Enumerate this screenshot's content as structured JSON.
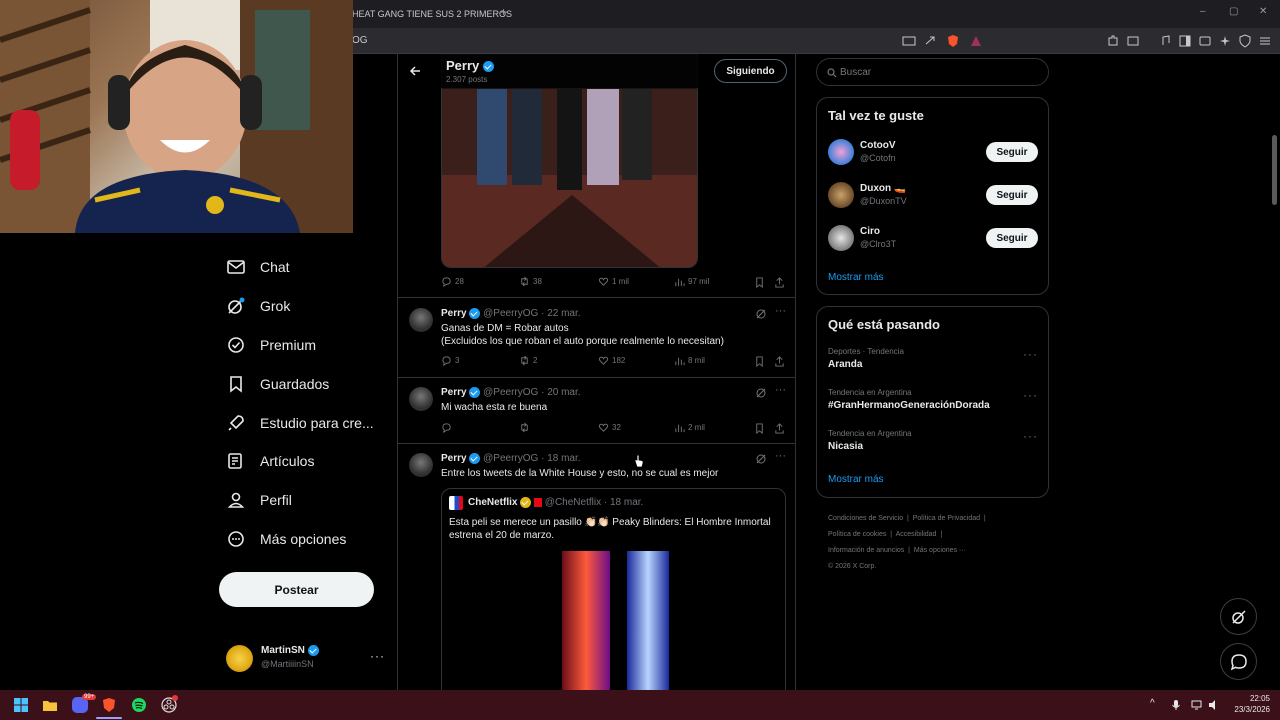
{
  "browser": {
    "tab_title": "HEAT GANG TIENE SUS 2 PRIMEROS",
    "tab_add": "+",
    "url": "OG",
    "window_controls": [
      "–",
      "▢",
      "✕"
    ]
  },
  "sidebar": {
    "items": [
      {
        "label": "Chat",
        "icon": "mail-icon"
      },
      {
        "label": "Grok",
        "icon": "grok-icon"
      },
      {
        "label": "Premium",
        "icon": "premium-icon"
      },
      {
        "label": "Guardados",
        "icon": "bookmark-icon"
      },
      {
        "label": "Estudio para cre...",
        "icon": "rocket-icon"
      },
      {
        "label": "Artículos",
        "icon": "articles-icon"
      },
      {
        "label": "Perfil",
        "icon": "profile-icon"
      },
      {
        "label": "Más opciones",
        "icon": "more-circle-icon"
      }
    ],
    "post_button": "Postear",
    "account": {
      "name": "MartinSN",
      "handle": "@MartiiiinSN",
      "more": "···"
    }
  },
  "header": {
    "name": "Perry",
    "posts": "2.307 posts",
    "following_button": "Siguiendo"
  },
  "tweets": [
    {
      "actions": {
        "replies": "28",
        "reposts": "38",
        "likes": "1 mil",
        "views": "97 mil"
      }
    },
    {
      "name": "Perry",
      "handle": "@PeerryOG",
      "date": "· 22 mar.",
      "text_line1": "Ganas de DM = Robar autos",
      "text_line2": "(Excluidos los que roban el auto porque realmente lo necesitan)",
      "actions": {
        "replies": "3",
        "reposts": "2",
        "likes": "182",
        "views": "8 mil"
      }
    },
    {
      "name": "Perry",
      "handle": "@PeerryOG",
      "date": "· 20 mar.",
      "text_line1": "Mi wacha esta re buena",
      "actions": {
        "replies": "",
        "reposts": "",
        "likes": "32",
        "views": "2 mil"
      }
    },
    {
      "name": "Perry",
      "handle": "@PeerryOG",
      "date": "· 18 mar.",
      "text_line1": "Entre los tweets de la White House y esto, no se cual es mejor",
      "quote": {
        "name": "CheNetflix",
        "handle": "@CheNetflix",
        "date": "· 18 mar.",
        "text_line1": "Esta peli se merece un pasillo 👏🏻👏🏻 Peaky Blinders: El Hombre Inmortal",
        "text_line2": "estrena el 20 de marzo."
      }
    }
  ],
  "right": {
    "search_placeholder": "Buscar",
    "suggest_title": "Tal vez te guste",
    "suggestions": [
      {
        "name": "CotooV",
        "handle": "@Cotofn",
        "button": "Seguir"
      },
      {
        "name": "Duxon 🚤",
        "handle": "@DuxonTV",
        "button": "Seguir"
      },
      {
        "name": "Ciro",
        "handle": "@Clro3T",
        "button": "Seguir"
      }
    ],
    "show_more": "Mostrar más",
    "trends_title": "Qué está pasando",
    "trends": [
      {
        "category": "Deportes · Tendencia",
        "name": "Aranda"
      },
      {
        "category": "Tendencia en Argentina",
        "name": "#GranHermanoGeneraciónDorada"
      },
      {
        "category": "Tendencia en Argentina",
        "name": "Nicasia"
      }
    ],
    "footer_line1": [
      "Condiciones de Servicio",
      "Política de Privacidad"
    ],
    "footer_line2": [
      "Política de cookies",
      "Accesibilidad"
    ],
    "footer_line3": [
      "Información de anuncios",
      "Más opciones ···"
    ],
    "copyright": "© 2026 X Corp."
  },
  "taskbar": {
    "time": "22:05",
    "date": "23/3/2026",
    "discord_badge": "99+"
  },
  "colors": {
    "accent": "#1d9bf0",
    "background": "#000000",
    "taskbar": "#3b1018"
  }
}
